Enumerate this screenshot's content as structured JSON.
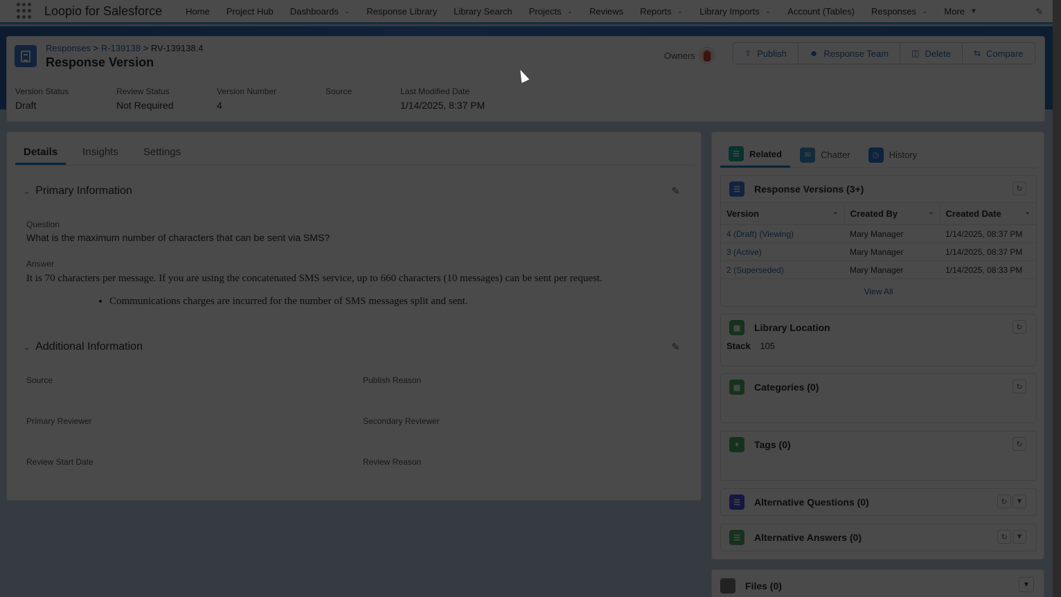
{
  "app": {
    "name": "Loopio for Salesforce",
    "nav": [
      {
        "label": "Home",
        "dropdown": false
      },
      {
        "label": "Project Hub",
        "dropdown": false
      },
      {
        "label": "Dashboards",
        "dropdown": true
      },
      {
        "label": "Response Library",
        "dropdown": false
      },
      {
        "label": "Library Search",
        "dropdown": false
      },
      {
        "label": "Projects",
        "dropdown": true
      },
      {
        "label": "Reviews",
        "dropdown": false
      },
      {
        "label": "Reports",
        "dropdown": true
      },
      {
        "label": "Library Imports",
        "dropdown": true
      },
      {
        "label": "Account (Tables)",
        "dropdown": false
      },
      {
        "label": "Responses",
        "dropdown": true
      },
      {
        "label": "More",
        "dropdown": true
      }
    ]
  },
  "header": {
    "breadcrumb": {
      "root": "Responses",
      "parent": "R-139138",
      "current": "RV-139138.4",
      "separator": ">"
    },
    "title": "Response Version",
    "owners_label": "Owners",
    "actions": [
      "Publish",
      "Response Team",
      "Delete",
      "Compare"
    ],
    "fields": [
      {
        "label": "Version Status",
        "value": "Draft"
      },
      {
        "label": "Review Status",
        "value": "Not Required"
      },
      {
        "label": "Version Number",
        "value": "4"
      },
      {
        "label": "Source",
        "value": ""
      },
      {
        "label": "Last Modified Date",
        "value": "1/14/2025, 8:37 PM"
      }
    ]
  },
  "detail": {
    "tabs": [
      "Details",
      "Insights",
      "Settings"
    ],
    "active_tab": "Details",
    "primary": {
      "title": "Primary Information",
      "question_label": "Question",
      "question": "What is the maximum number of characters that can be sent via SMS?",
      "answer_label": "Answer",
      "answer": "It is 70 characters per message. If you are using the concatenated SMS service, up to 660 characters (10 messages) can be sent per request.",
      "answer_bullet": "Communications charges are incurred for the number of SMS messages split and sent."
    },
    "additional": {
      "title": "Additional Information",
      "fields": [
        {
          "label": "Source",
          "value": ""
        },
        {
          "label": "Publish Reason",
          "value": ""
        },
        {
          "label": "Primary Reviewer",
          "value": ""
        },
        {
          "label": "Secondary Reviewer",
          "value": ""
        },
        {
          "label": "Review Start Date",
          "value": ""
        },
        {
          "label": "Review Reason",
          "value": ""
        }
      ]
    }
  },
  "related": {
    "tabs": [
      "Related",
      "Chatter",
      "History"
    ],
    "active_tab": "Related",
    "versions": {
      "title": "Response Versions (3+)",
      "columns": [
        "Version",
        "Created By",
        "Created Date"
      ],
      "rows": [
        {
          "version": "4 (Draft) (Viewing)",
          "created_by": "Mary Manager",
          "created_date": "1/14/2025, 08:37 PM"
        },
        {
          "version": "3 (Active)",
          "created_by": "Mary Manager",
          "created_date": "1/14/2025, 08:37 PM"
        },
        {
          "version": "2 (Superseded)",
          "created_by": "Mary Manager",
          "created_date": "1/14/2025, 08:33 PM"
        }
      ],
      "view_all": "View All"
    },
    "library_location": {
      "title": "Library Location",
      "stack_label": "Stack",
      "stack_value": "105"
    },
    "categories": {
      "title": "Categories (0)"
    },
    "tags": {
      "title": "Tags (0)"
    },
    "alt_questions": {
      "title": "Alternative Questions (0)"
    },
    "alt_answers": {
      "title": "Alternative Answers (0)"
    },
    "files": {
      "title": "Files (0)"
    }
  },
  "colors": {
    "brand_blue": "#0176d3",
    "link": "#0b5cab",
    "record_icon": "#2e6fd6",
    "related_icon": "#06a59a",
    "chatter_icon": "#2e8fce",
    "history_icon": "#1b6ed6",
    "library_icon": "#3ba755",
    "alt_q_icon": "#3a49da",
    "overlay": "rgba(8,7,7,0.73)"
  },
  "icons": {
    "app_launcher": "waffle-grid-icon",
    "record": "document-icon",
    "publish": "upload-icon",
    "team": "user-icon",
    "delete": "trash-icon",
    "compare": "swap-icon",
    "edit": "pencil-icon",
    "refresh": "refresh-icon"
  }
}
